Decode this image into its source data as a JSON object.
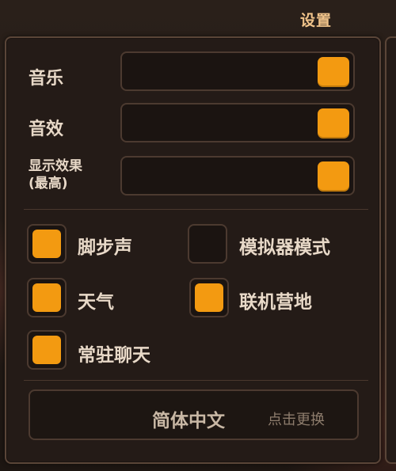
{
  "title": "设置",
  "sliders": [
    {
      "label": "音乐",
      "value": 1.0
    },
    {
      "label": "音效",
      "value": 1.0
    },
    {
      "label": "显示效果",
      "label_line2": "(最高)",
      "value": 1.0
    }
  ],
  "toggles": [
    {
      "label": "脚步声",
      "checked": true
    },
    {
      "label": "模拟器模式",
      "checked": false
    },
    {
      "label": "天气",
      "checked": true
    },
    {
      "label": "联机营地",
      "checked": true
    },
    {
      "label": "常驻聊天",
      "checked": true
    }
  ],
  "language": {
    "current": "简体中文",
    "change_label": "点击更换"
  },
  "colors": {
    "accent": "#f39a11",
    "title": "#f0c38a",
    "panel": "#241b17",
    "border": "#5a4538"
  }
}
